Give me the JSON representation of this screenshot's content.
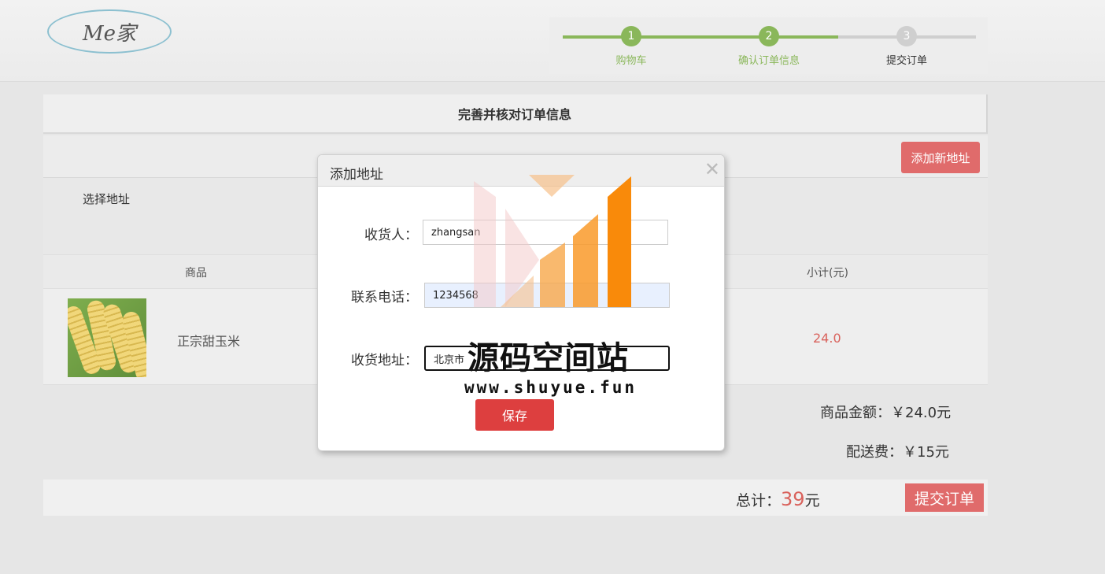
{
  "header": {
    "logo_text": "Me家",
    "steps": [
      {
        "number": "1",
        "label": "购物车",
        "state": "done"
      },
      {
        "number": "2",
        "label": "确认订单信息",
        "state": "done"
      },
      {
        "number": "3",
        "label": "提交订单",
        "state": "todo"
      }
    ]
  },
  "order": {
    "title": "完善并核对订单信息",
    "add_address_button": "添加新地址",
    "select_address_label": "选择地址",
    "columns": {
      "goods": "商品",
      "subtotal": "小计(元)"
    },
    "items": [
      {
        "name": "正宗甜玉米",
        "subtotal": "24.0",
        "image": "corn-image"
      }
    ],
    "goods_amount_label": "商品金额：",
    "goods_amount_value": "￥24.0元",
    "shipping_label": "配送费：",
    "shipping_value": "￥15元",
    "total_label": "总计：",
    "total_value": "39",
    "total_unit": "元",
    "submit_button": "提交订单"
  },
  "modal": {
    "title": "添加地址",
    "close_icon": "close-icon",
    "fields": {
      "receiver_label": "收货人：",
      "receiver_value": "zhangsan",
      "phone_label": "联系电话：",
      "phone_value": "1234568",
      "address_label": "收货地址：",
      "address_value": "北京市"
    },
    "save_button": "保存"
  },
  "watermark": {
    "title": "源码空间站",
    "url": "www.shuyue.fun"
  },
  "colors": {
    "accent_green": "#8ab75a",
    "accent_red": "#e06b6b",
    "price_red": "#d9625c",
    "save_red": "#dd3f3f",
    "watermark_orange": "#f98a0a"
  }
}
